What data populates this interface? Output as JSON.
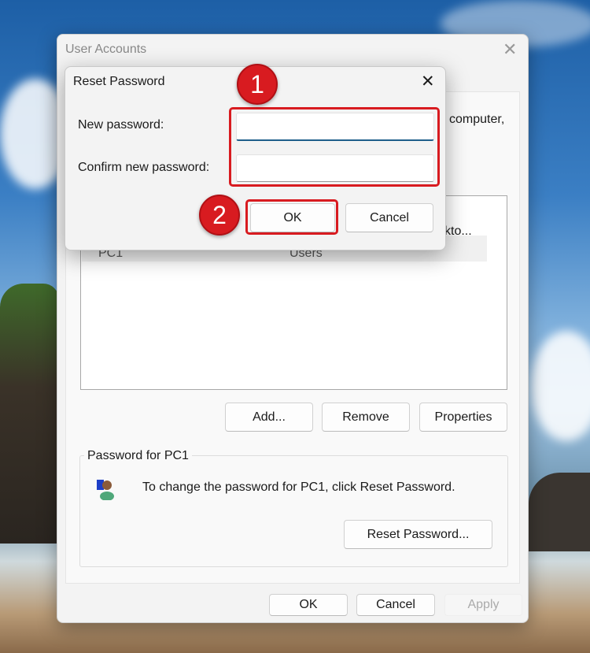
{
  "user_accounts": {
    "title": "User Accounts",
    "partial_text": "computer,",
    "list_partial_name": "PC1",
    "list_partial_group": "Users",
    "list_partial_extra": "kto...",
    "buttons": {
      "add": "Add...",
      "remove": "Remove",
      "properties": "Properties"
    },
    "group_label": "Password for PC1",
    "info_text": "To change the password for PC1, click Reset Password.",
    "reset_button": "Reset Password...",
    "footer": {
      "ok": "OK",
      "cancel": "Cancel",
      "apply": "Apply"
    }
  },
  "reset_dialog": {
    "title": "Reset Password",
    "new_password_label": "New password:",
    "new_password_value": "",
    "confirm_label": "Confirm new password:",
    "confirm_value": "",
    "ok": "OK",
    "cancel": "Cancel"
  },
  "annotations": {
    "step1": "1",
    "step2": "2",
    "highlight_color": "#d81b20"
  }
}
